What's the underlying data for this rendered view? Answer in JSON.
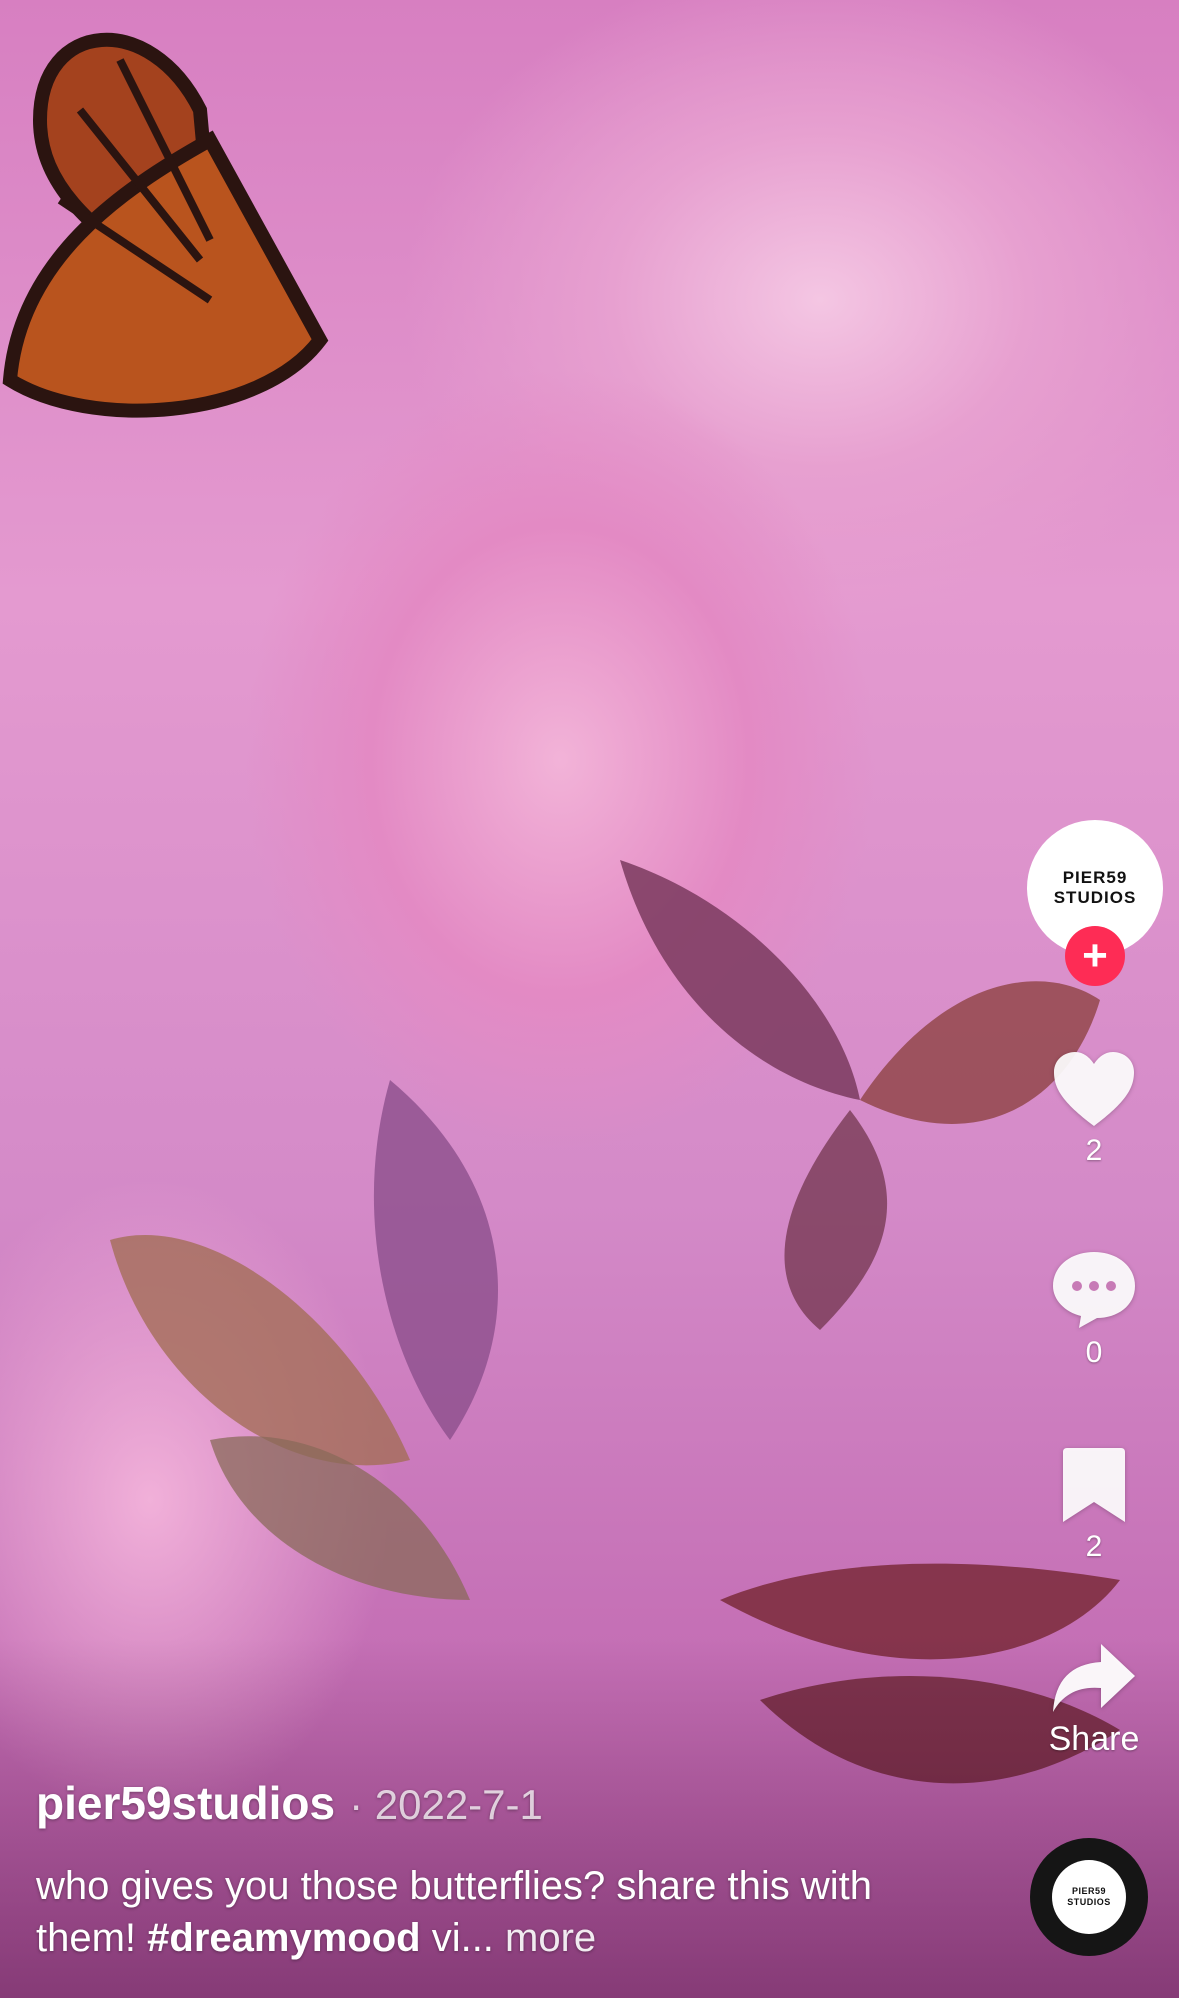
{
  "profile": {
    "avatar_line1": "PIER59",
    "avatar_line2": "STUDIOS",
    "follow_symbol": "+"
  },
  "actions": {
    "likes": "2",
    "comments": "0",
    "saves": "2",
    "share_label": "Share"
  },
  "post": {
    "username": "pier59studios",
    "date": "· 2022-7-1",
    "caption_text": "who gives you those butterflies? share this with them! ",
    "hashtag": "#dreamymood",
    "caption_tail": " vi...",
    "more_label": "more"
  },
  "music": {
    "disc_line1": "PIER59",
    "disc_line2": "STUDIOS"
  },
  "icons": {
    "like": "heart-icon",
    "comment": "comment-bubble-icon",
    "save": "bookmark-icon",
    "share": "share-arrow-icon",
    "follow": "plus-icon"
  },
  "colors": {
    "follow_accent": "#fe2c55",
    "text": "#ffffff"
  }
}
